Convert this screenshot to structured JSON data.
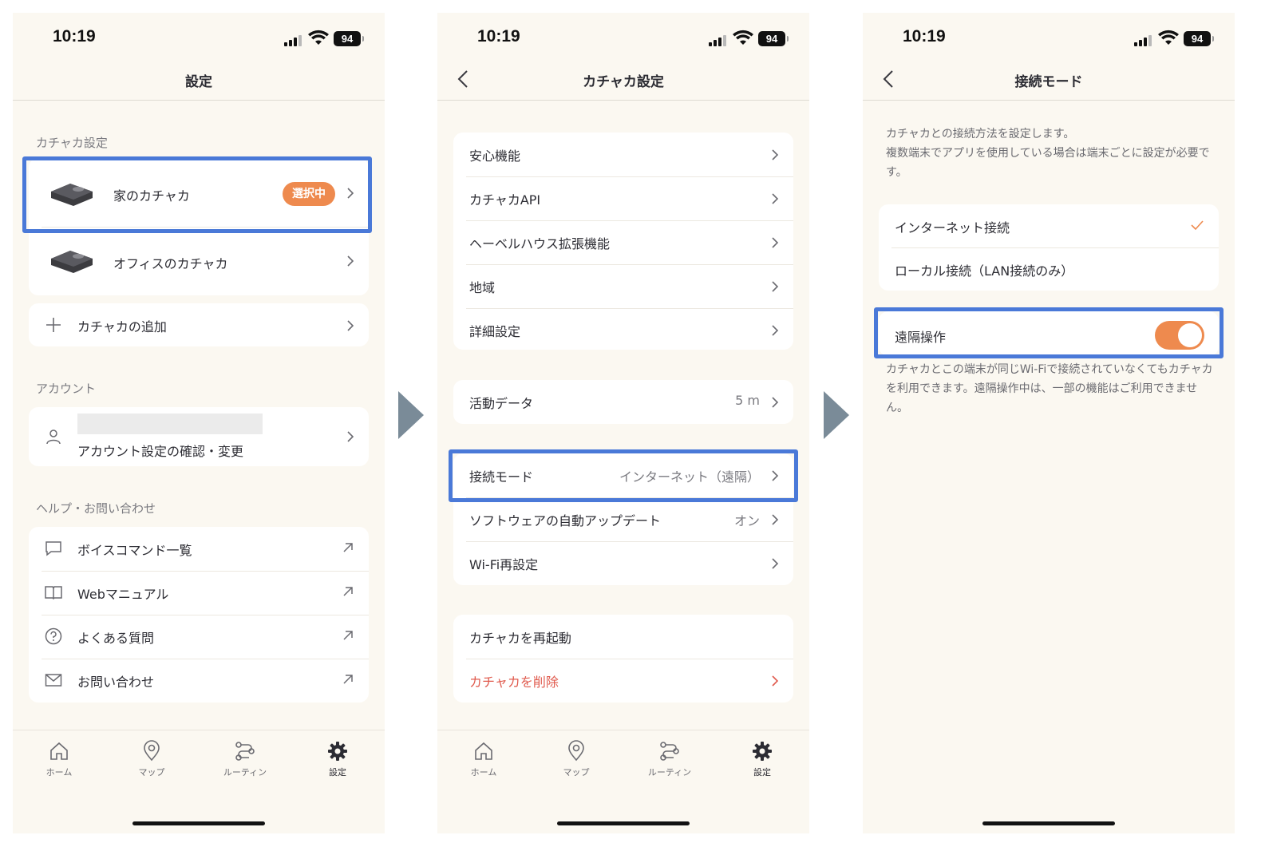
{
  "status_bar": {
    "time": "10:19",
    "battery": "94"
  },
  "screen1": {
    "title": "設定",
    "section_devices": "カチャカ設定",
    "devices": [
      {
        "name": "家のカチャカ",
        "badge": "選択中"
      },
      {
        "name": "オフィスのカチャカ"
      }
    ],
    "add_device": "カチャカの追加",
    "section_account": "アカウント",
    "account_label": "アカウント設定の確認・変更",
    "section_help": "ヘルプ・お問い合わせ",
    "help_items": [
      "ボイスコマンド一覧",
      "Webマニュアル",
      "よくある質問",
      "お問い合わせ"
    ]
  },
  "screen2": {
    "title": "カチャカ設定",
    "group1": [
      "安心機能",
      "カチャカAPI",
      "ヘーベルハウス拡張機能",
      "地域",
      "詳細設定"
    ],
    "activity": {
      "label": "活動データ",
      "value": "5 m"
    },
    "connection": {
      "label": "接続モード",
      "value": "インターネット（遠隔）"
    },
    "auto_update": {
      "label": "ソフトウェアの自動アップデート",
      "value": "オン"
    },
    "wifi": "Wi-Fi再設定",
    "restart": "カチャカを再起動",
    "delete": "カチャカを削除"
  },
  "screen3": {
    "title": "接続モード",
    "description": "カチャカとの接続方法を設定します。\n複数端末でアプリを使用している場合は端末ごとに設定が必要です。",
    "options": [
      {
        "label": "インターネット接続",
        "selected": true
      },
      {
        "label": "ローカル接続（LAN接続のみ）",
        "selected": false
      }
    ],
    "remote_label": "遠隔操作",
    "remote_enabled": true,
    "remote_note": "カチャカとこの端末が同じWi-Fiで接続されていなくてもカチャカを利用できます。遠隔操作中は、一部の機能はご利用できません。"
  },
  "tabbar": {
    "home": "ホーム",
    "map": "マップ",
    "routine": "ルーティン",
    "settings": "設定"
  },
  "colors": {
    "accent": "#ee8a4e",
    "highlight": "#4a79d8",
    "danger": "#e05a4d",
    "background": "#fbf8f1"
  }
}
